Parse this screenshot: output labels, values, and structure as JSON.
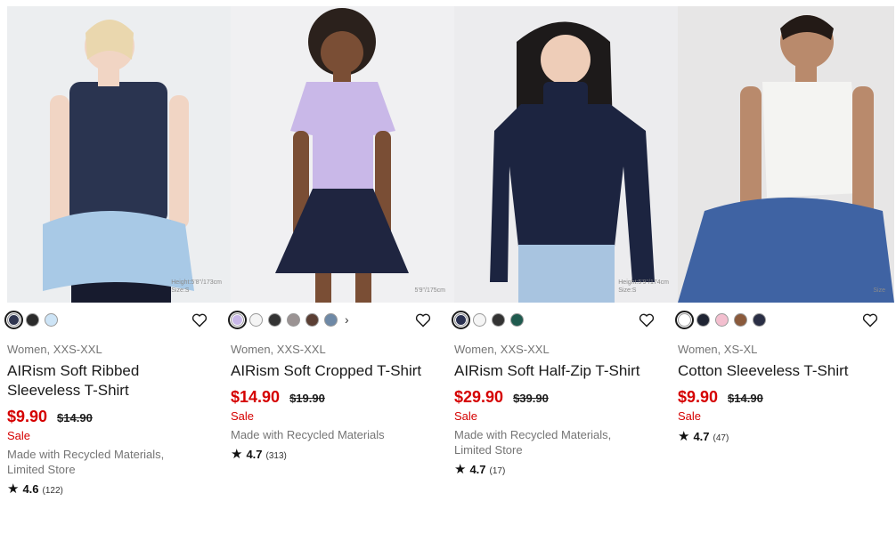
{
  "products": [
    {
      "swatches": [
        "#2f3550",
        "#2b2b2b",
        "#cde4f6"
      ],
      "selected_swatch": 0,
      "has_more": false,
      "height_note_1": "Height:5'8\"/173cm",
      "height_note_2": "Size:S",
      "gender": "Women, XXS-XXL",
      "name": "AIRism Soft Ribbed Sleeveless T-Shirt",
      "price": "$9.90",
      "original_price": "$14.90",
      "sale": "Sale",
      "flags": "Made with Recycled Materials, Limited Store",
      "rating": "4.6",
      "reviews": "(122)"
    },
    {
      "swatches": [
        "#c9b8e8",
        "#f5f5f5",
        "#333333",
        "#9b9393",
        "#5b3f34",
        "#6e89a6"
      ],
      "selected_swatch": 0,
      "has_more": true,
      "more_icon": "›",
      "height_note_1": "5'9\"/175cm",
      "height_note_2": "",
      "gender": "Women, XXS-XXL",
      "name": "AIRism Soft Cropped T-Shirt",
      "price": "$14.90",
      "original_price": "$19.90",
      "sale": "Sale",
      "flags": "Made with Recycled Materials",
      "rating": "4.7",
      "reviews": "(313)"
    },
    {
      "swatches": [
        "#2b3252",
        "#f5f5f5",
        "#333333",
        "#1f5a4e"
      ],
      "selected_swatch": 0,
      "has_more": false,
      "height_note_1": "Height:5'9\"/174cm",
      "height_note_2": "Size:S",
      "gender": "Women, XXS-XXL",
      "name": "AIRism Soft Half-Zip T-Shirt",
      "price": "$29.90",
      "original_price": "$39.90",
      "sale": "Sale",
      "flags": "Made with Recycled Materials, Limited Store",
      "rating": "4.7",
      "reviews": "(17)"
    },
    {
      "swatches": [
        "#ffffff",
        "#1f2433",
        "#f3bfcf",
        "#8a5a3c",
        "#2a2f45"
      ],
      "selected_swatch": 0,
      "has_more": false,
      "height_note_1": "Size",
      "height_note_2": "",
      "gender": "Women, XS-XL",
      "name": "Cotton Sleeveless T-Shirt",
      "price": "$9.90",
      "original_price": "$14.90",
      "sale": "Sale",
      "flags": "",
      "rating": "4.7",
      "reviews": "(47)"
    }
  ]
}
